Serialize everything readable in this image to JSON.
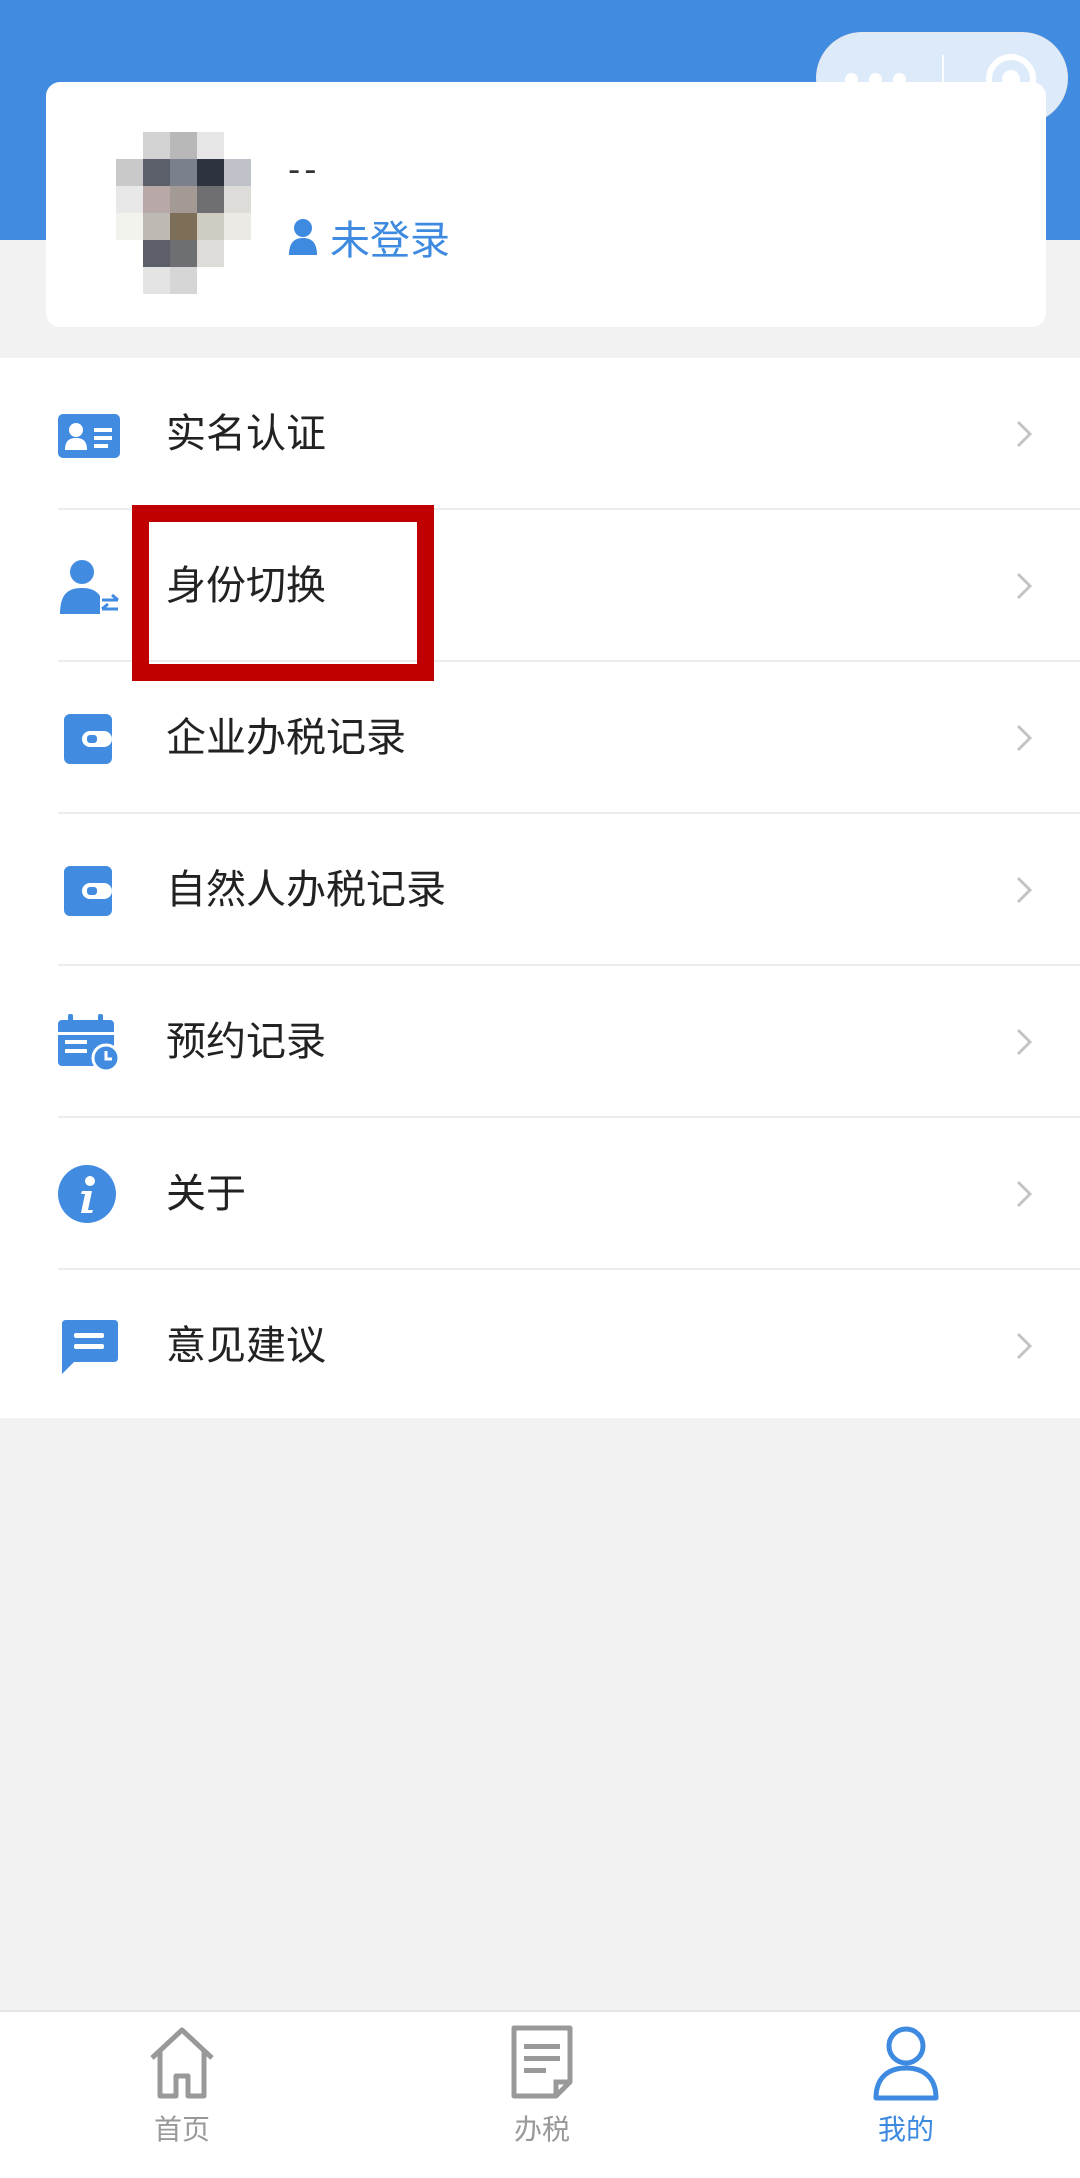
{
  "capsule": {
    "more_icon": "more-dots-icon",
    "close_icon": "close-target-icon"
  },
  "profile": {
    "name": "--",
    "status": "未登录",
    "status_icon": "user-icon"
  },
  "menu": [
    {
      "label": "实名认证",
      "icon": "id-card-icon"
    },
    {
      "label": "身份切换",
      "icon": "user-switch-icon"
    },
    {
      "label": "企业办税记录",
      "icon": "wallet-icon"
    },
    {
      "label": "自然人办税记录",
      "icon": "wallet-icon"
    },
    {
      "label": "预约记录",
      "icon": "calendar-clock-icon"
    },
    {
      "label": "关于",
      "icon": "info-icon"
    },
    {
      "label": "意见建议",
      "icon": "message-icon"
    }
  ],
  "tabs": [
    {
      "label": "首页",
      "icon": "home-icon"
    },
    {
      "label": "办税",
      "icon": "document-icon"
    },
    {
      "label": "我的",
      "icon": "person-icon",
      "active": true
    }
  ],
  "colors": {
    "brand": "#418be1",
    "highlight": "#c00000",
    "active_tab": "#3d8ae0",
    "inactive_tab": "#999999"
  }
}
